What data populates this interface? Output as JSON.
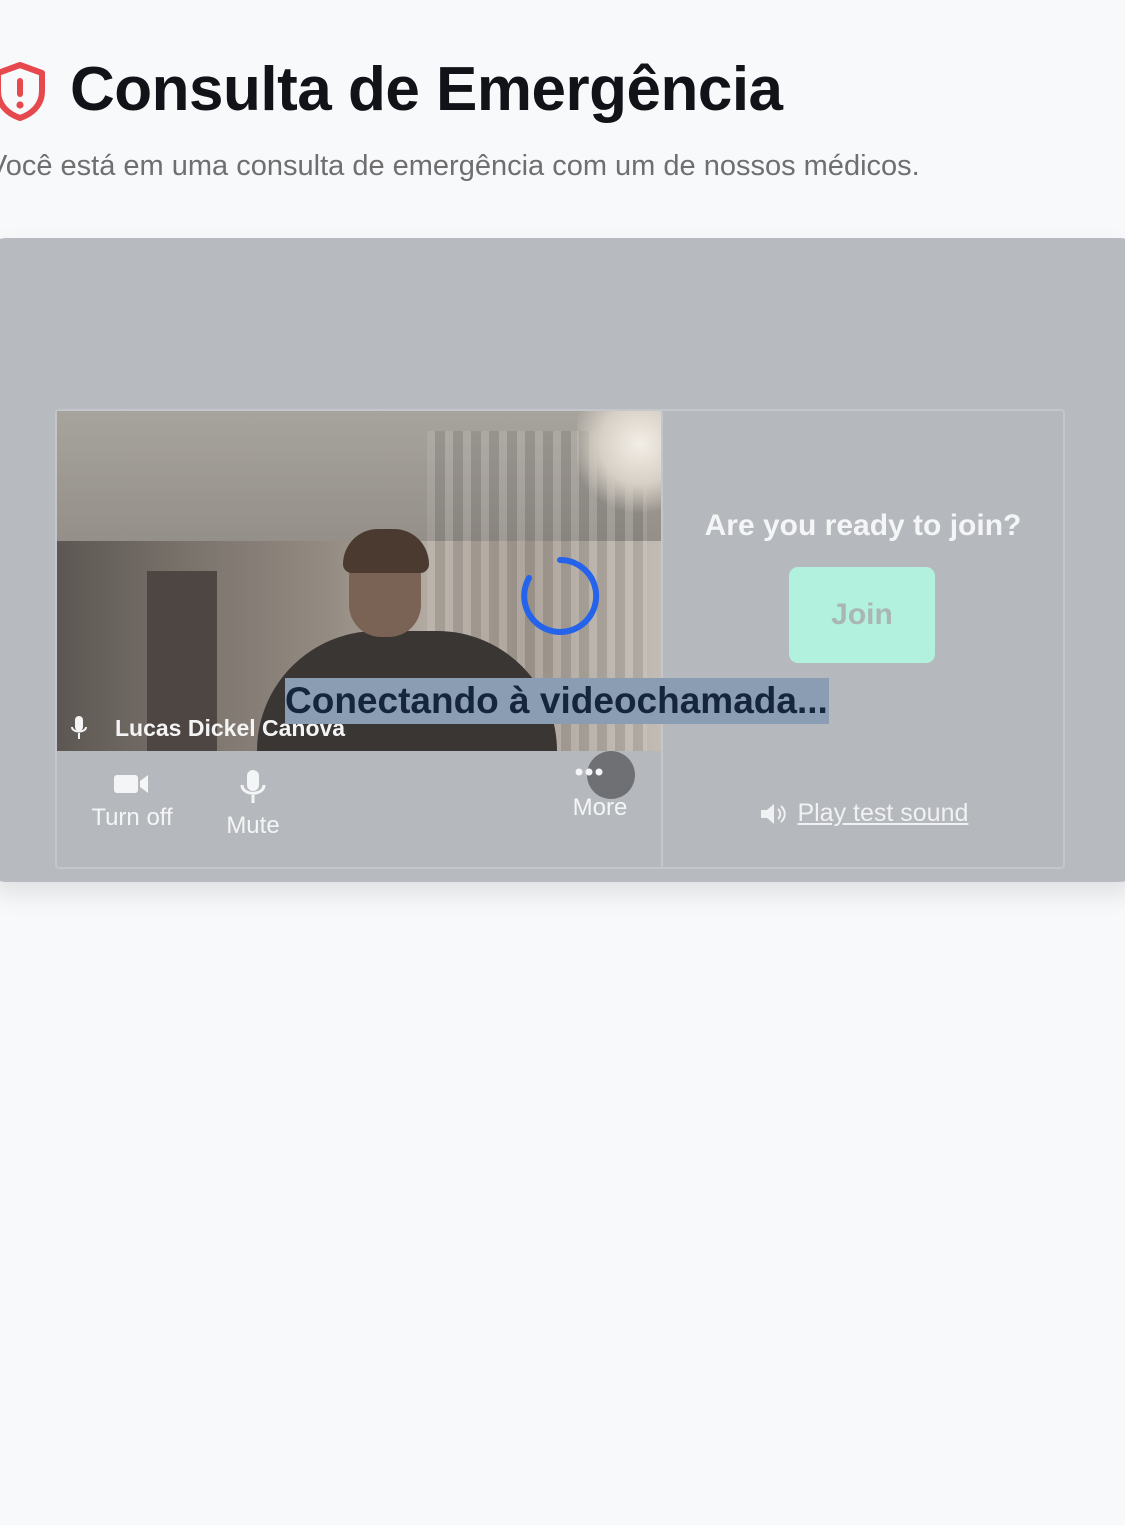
{
  "header": {
    "title": "Consulta de Emergência",
    "subtitle": "Você está em uma consulta de emergência com um de nossos médicos."
  },
  "prejoin": {
    "participant_name": "Lucas Dickel Canova",
    "controls": {
      "camera_label": "Turn off",
      "mic_label": "Mute",
      "more_label": "More"
    },
    "ready_question": "Are you ready to join?",
    "join_label": "Join",
    "test_sound_label": "Play test sound"
  },
  "status": {
    "connecting_text": "Conectando à videochamada..."
  },
  "colors": {
    "shield": "#e5484d",
    "spinner": "#2563eb",
    "join_button": "#b3f1df"
  },
  "icons": [
    "shield-alert-icon",
    "microphone-icon",
    "camera-icon",
    "more-dots-icon",
    "speaker-icon",
    "loading-spinner"
  ]
}
